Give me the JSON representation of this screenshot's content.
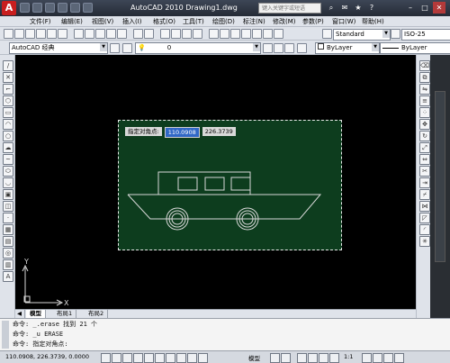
{
  "titlebar": {
    "logo": "A",
    "title": "AutoCAD 2010  Drawing1.dwg",
    "search_placeholder": "键入关键字或短语"
  },
  "menu": [
    "文件(F)",
    "编辑(E)",
    "视图(V)",
    "插入(I)",
    "格式(O)",
    "工具(T)",
    "绘图(D)",
    "标注(N)",
    "修改(M)",
    "参数(P)",
    "窗口(W)",
    "帮助(H)"
  ],
  "toolbar": {
    "text_style": "Standard",
    "dim_style": "ISO-25",
    "workspace": "AutoCAD 经典",
    "layer": "0",
    "color": "ByLayer",
    "linetype": "ByLayer"
  },
  "drawing": {
    "tooltip_label": "指定对角点:",
    "tooltip_x": "110.0908",
    "tooltip_y": "226.3739",
    "ucs_x": "X",
    "ucs_y": "Y"
  },
  "tabs": [
    "模型",
    "布局1",
    "布局2"
  ],
  "command": {
    "lines": [
      "命令: _.erase 找到 21 个",
      "命令: _u ERASE",
      "命令: 指定对角点:"
    ]
  },
  "status": {
    "coords": "110.0908, 226.3739, 0.0000",
    "model": "模型",
    "scale": "1:1"
  },
  "colors": {
    "selection_fill": "#0d3d1e",
    "canvas": "#000000",
    "boat_stroke": "#d8d8d8",
    "tooltip_highlight": "#3168c6"
  }
}
